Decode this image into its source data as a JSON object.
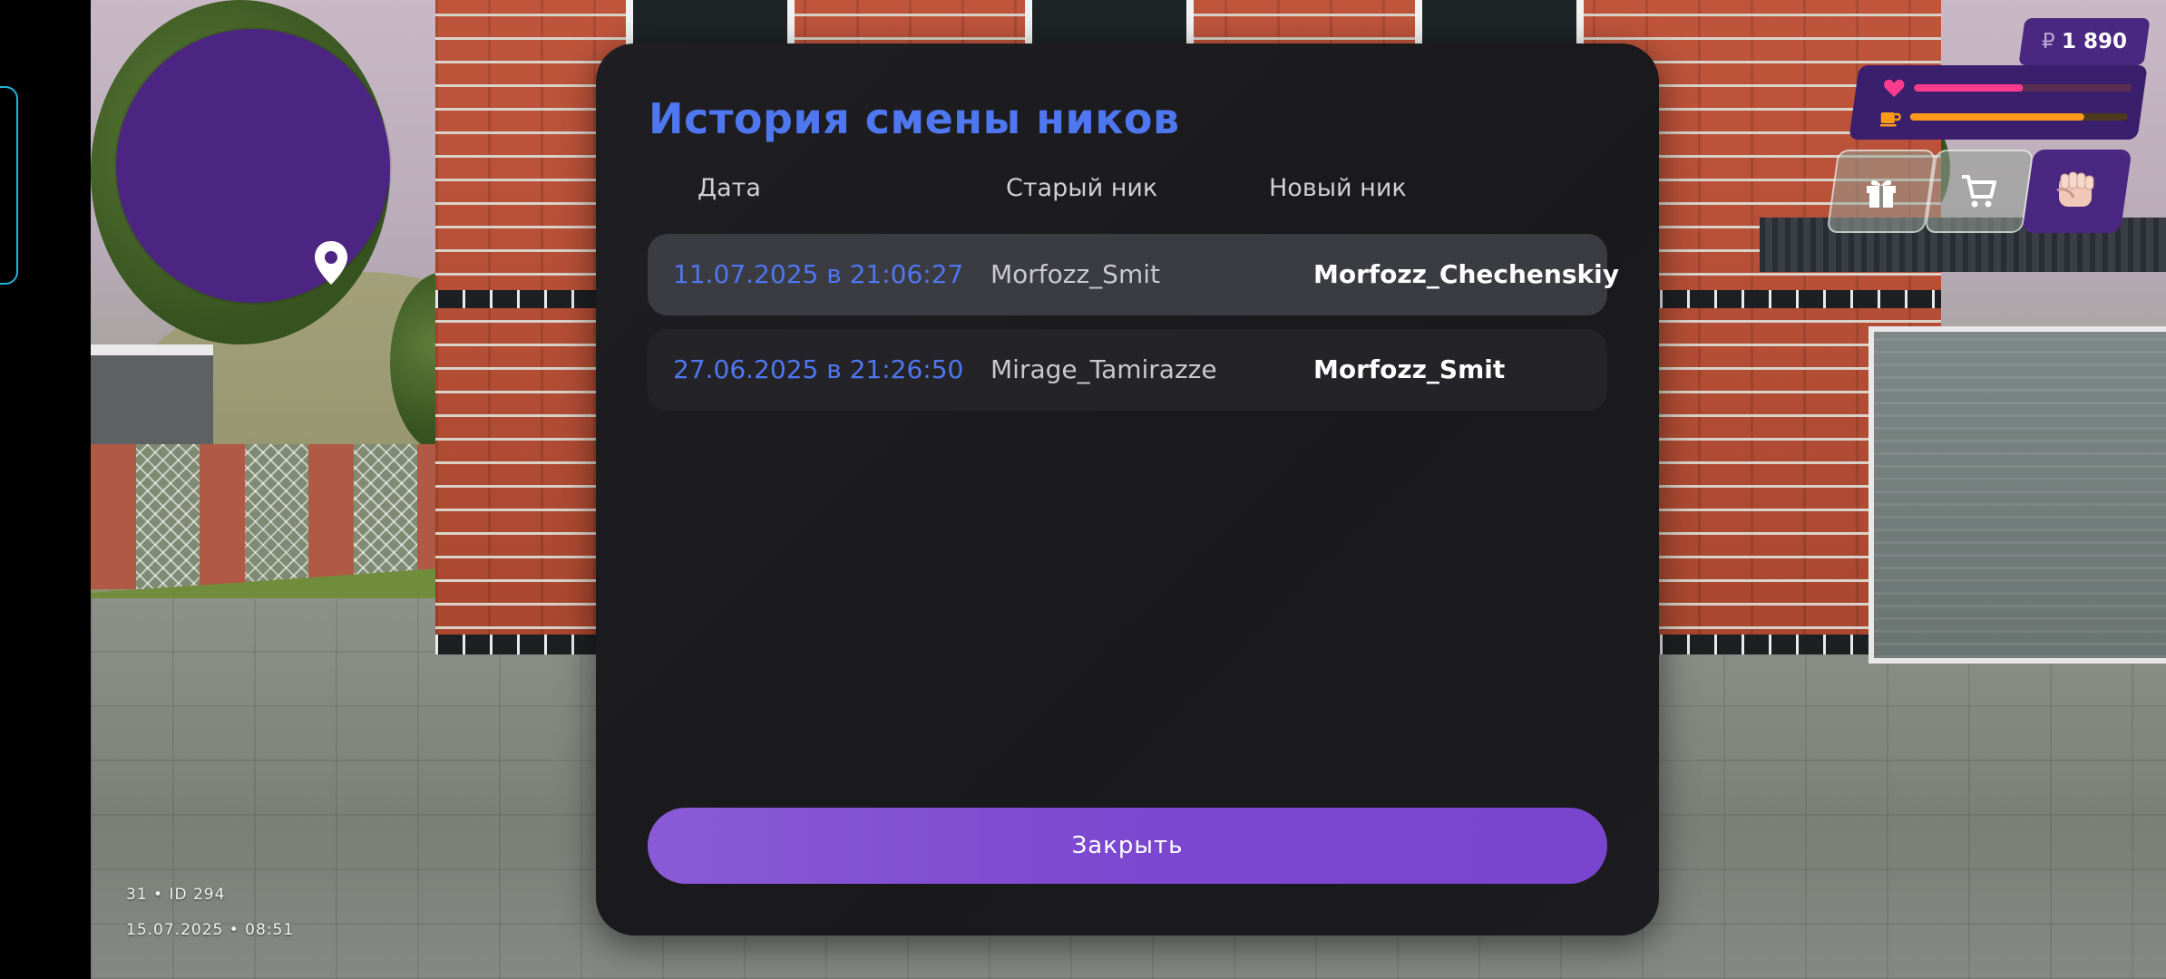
{
  "hud": {
    "money": "1 890",
    "currency_symbol": "₽",
    "health_level": 0.5,
    "hunger_level": 0.8,
    "health_color": "#ff3b8d",
    "hunger_color": "#ff9a1a"
  },
  "player_info": {
    "line1": "31 • ID 294",
    "line2": "15.07.2025 • 08:51"
  },
  "modal": {
    "title": "История смены ников",
    "columns": [
      "Дата",
      "Старый ник",
      "Новый ник"
    ],
    "rows": [
      {
        "date": "11.07.2025 в 21:06:27",
        "old_nick": "Morfozz_Smit",
        "new_nick": "Morfozz_Chechenskiy"
      },
      {
        "date": "27.06.2025 в 21:26:50",
        "old_nick": "Mirage_Tamirazze",
        "new_nick": "Morfozz_Smit"
      }
    ],
    "close_label": "Закрыть"
  },
  "colors": {
    "accent_blue": "#4f77f0",
    "accent_purple": "#7b46d0",
    "minimap": "#4c2482"
  },
  "icons": [
    "map-pin-icon",
    "heart-icon",
    "coffee-icon",
    "gift-icon",
    "cart-icon",
    "fist-icon"
  ]
}
